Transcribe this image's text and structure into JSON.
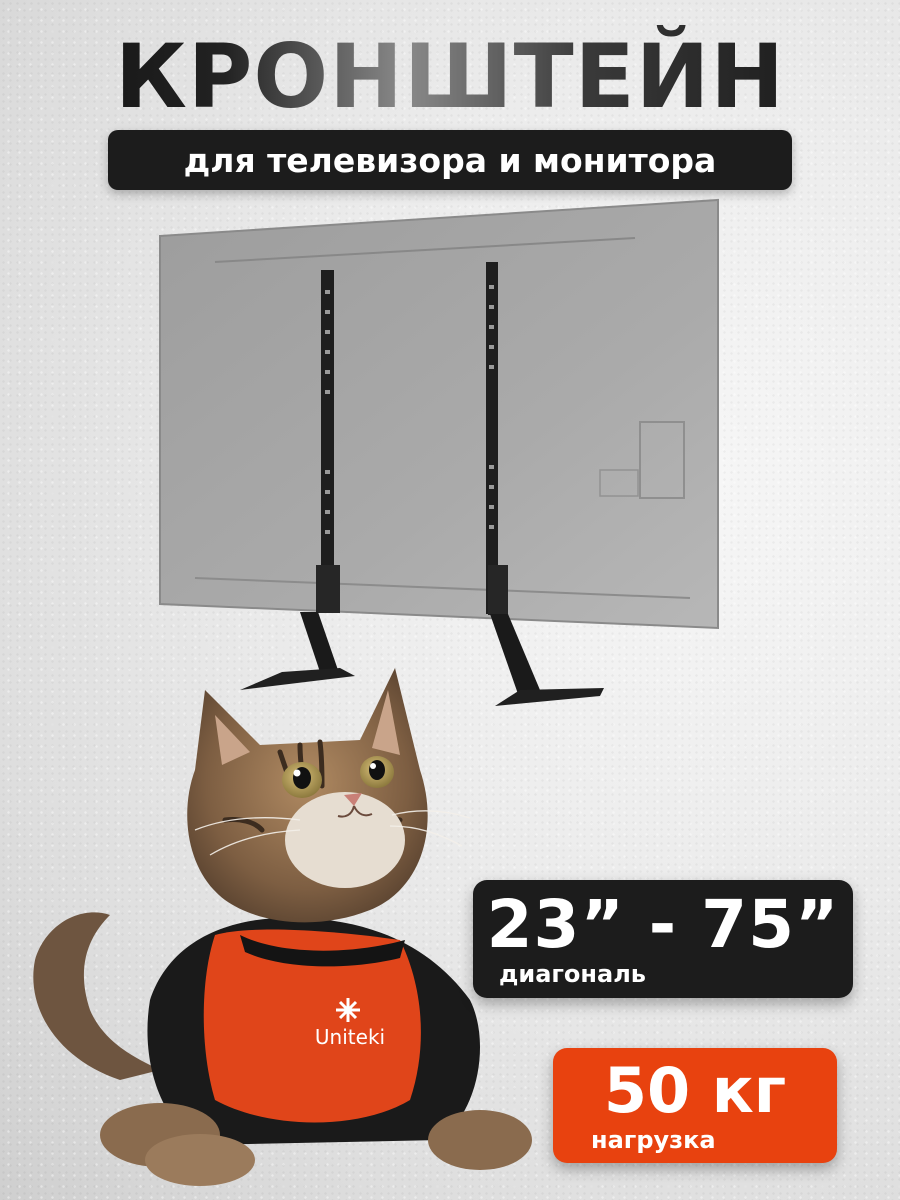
{
  "header": {
    "title": "КРОНШТЕЙН",
    "subtitle": "для телевизора и монитора"
  },
  "diagonal_badge": {
    "value": "23” - 75”",
    "label": "диагональ"
  },
  "load_badge": {
    "value": "50 кг",
    "label": "нагрузка"
  },
  "shirt_brand": "Uniteki",
  "colors": {
    "accent": "#e8420f",
    "dark": "#1c1c1c",
    "background": "#e6e6e6"
  }
}
